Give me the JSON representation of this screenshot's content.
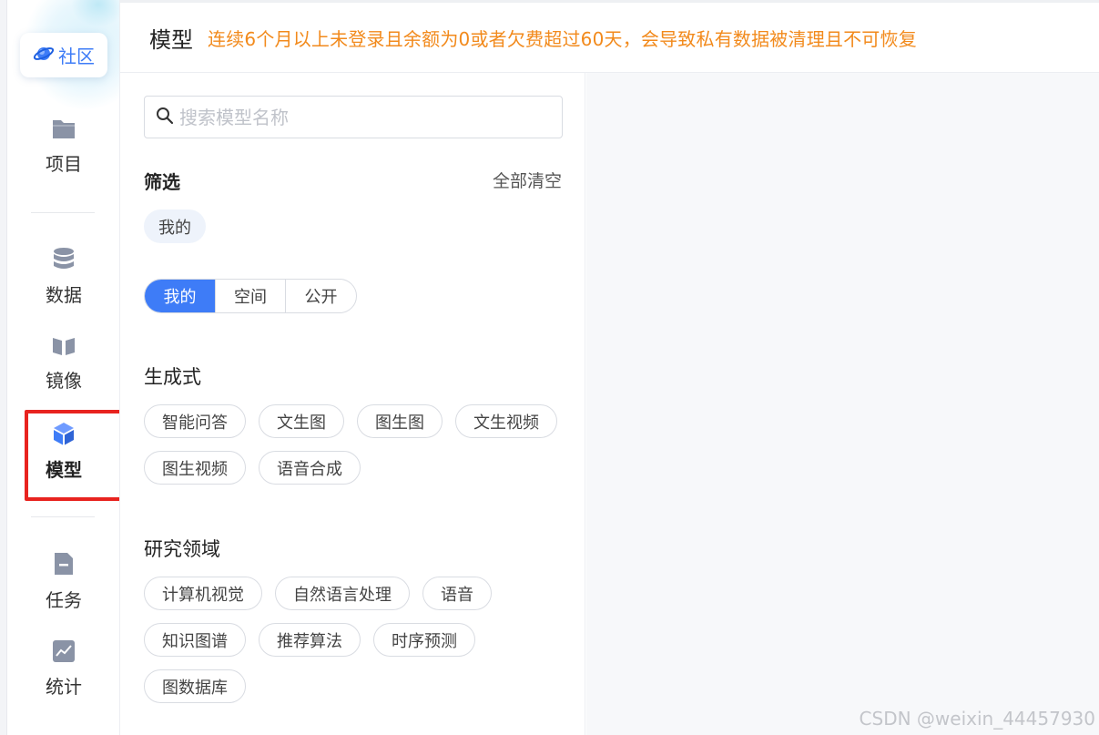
{
  "sidebar": {
    "community_label": "社区",
    "items": [
      {
        "label": "项目",
        "icon": "folder-icon"
      },
      {
        "label": "数据",
        "icon": "database-icon"
      },
      {
        "label": "镜像",
        "icon": "mirror-icon"
      },
      {
        "label": "模型",
        "icon": "cube-icon",
        "active": true
      },
      {
        "label": "任务",
        "icon": "task-file-icon"
      },
      {
        "label": "统计",
        "icon": "chart-icon"
      }
    ]
  },
  "header": {
    "title": "模型",
    "notice": "连续6个月以上未登录且余额为0或者欠费超过60天，会导致私有数据被清理且不可恢复"
  },
  "panel": {
    "search_placeholder": "搜索模型名称",
    "filter_title": "筛选",
    "clear_all": "全部清空",
    "selected_chip": "我的",
    "segments": [
      "我的",
      "空间",
      "公开"
    ],
    "active_segment": "我的",
    "groups": [
      {
        "title": "生成式",
        "tags": [
          "智能问答",
          "文生图",
          "图生图",
          "文生视频",
          "图生视频",
          "语音合成"
        ]
      },
      {
        "title": "研究领域",
        "tags": [
          "计算机视觉",
          "自然语言处理",
          "语音",
          "知识图谱",
          "推荐算法",
          "时序预测",
          "图数据库"
        ]
      }
    ]
  },
  "watermark": "CSDN @weixin_44457930",
  "colors": {
    "accent": "#3e7cf7",
    "notice": "#f28a1c",
    "highlight": "#e8231f",
    "icon_gray": "#8a93a6"
  }
}
